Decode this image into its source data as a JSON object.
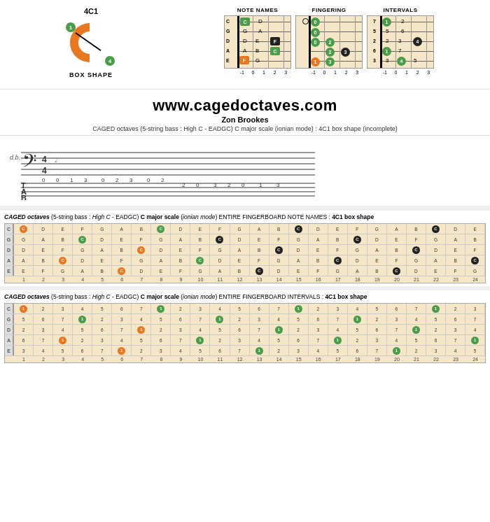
{
  "header": {
    "shape_label": "4C1",
    "box_shape_text": "BOX SHAPE",
    "dot1_label": "1",
    "dot4_label": "4",
    "diagrams": [
      {
        "title": "NOTE NAMES",
        "strings": [
          "C",
          "G",
          "D",
          "A",
          "E"
        ],
        "fret_nums": [
          "-1",
          "0",
          "1",
          "2",
          "3"
        ]
      },
      {
        "title": "FINGERING",
        "strings": [
          "0",
          "0",
          "0",
          "2",
          "1"
        ],
        "fret_nums": [
          "-1",
          "0",
          "1",
          "2",
          "3"
        ]
      },
      {
        "title": "INTERVALS",
        "strings": [
          "1",
          "5",
          "2",
          "6",
          "3"
        ],
        "fret_nums": [
          "-1",
          "0",
          "1",
          "2",
          "3"
        ]
      }
    ]
  },
  "website": {
    "url": "www.cagedoctaves.com",
    "author": "Zon Brookes",
    "description": "CAGED octaves (5-string bass : High C - EADGC) C major scale (ionian mode) : 4C1 box shape (incomplete)"
  },
  "fingerboard_notes": {
    "title_parts": {
      "caged": "CAGED octaves",
      "bass": "(5-string bass : High C - EADGC)",
      "scale": "C major scale",
      "mode": "(ionian mode)",
      "rest": "ENTIRE FINGERBOARD NOTE NAMES :",
      "shape": "4C1 box shape"
    },
    "string_names": [
      "C",
      "G",
      "D",
      "A",
      "E"
    ],
    "fret_count": 25,
    "fret_nums": [
      "1",
      "2",
      "3",
      "4",
      "5",
      "6",
      "7",
      "8",
      "9",
      "10",
      "11",
      "12",
      "13",
      "14",
      "15",
      "16",
      "17",
      "18",
      "19",
      "20",
      "21",
      "22",
      "23",
      "24"
    ],
    "rows": [
      {
        "string": "C",
        "cells": [
          "C",
          "D",
          "E",
          "F",
          "G",
          "A",
          "B",
          "C",
          "D",
          "E",
          "F",
          "G",
          "A",
          "B",
          "C",
          "D",
          "E",
          "F",
          "G",
          "A",
          "B",
          "C",
          "D",
          "E"
        ]
      },
      {
        "string": "G",
        "cells": [
          "G",
          "A",
          "B",
          "C",
          "D",
          "E",
          "F",
          "G",
          "A",
          "B",
          "C",
          "D",
          "E",
          "F",
          "G",
          "A",
          "B",
          "C",
          "D",
          "E",
          "F",
          "G",
          "A",
          "B"
        ]
      },
      {
        "string": "D",
        "cells": [
          "D",
          "E",
          "F",
          "G",
          "A",
          "B",
          "C",
          "D",
          "E",
          "F",
          "G",
          "A",
          "B",
          "C",
          "D",
          "E",
          "F",
          "G",
          "A",
          "B",
          "C",
          "D",
          "E",
          "F"
        ]
      },
      {
        "string": "A",
        "cells": [
          "A",
          "B",
          "C",
          "D",
          "E",
          "F",
          "G",
          "A",
          "B",
          "C",
          "D",
          "E",
          "F",
          "G",
          "A",
          "B",
          "C",
          "D",
          "E",
          "F",
          "G",
          "A",
          "B",
          "C"
        ]
      },
      {
        "string": "E",
        "cells": [
          "E",
          "F",
          "G",
          "A",
          "B",
          "C",
          "D",
          "E",
          "F",
          "G",
          "A",
          "B",
          "C",
          "D",
          "E",
          "F",
          "G",
          "A",
          "B",
          "C",
          "D",
          "E",
          "F",
          "G"
        ]
      }
    ],
    "highlights": {
      "orange": [
        [
          0,
          0
        ],
        [
          1,
          7
        ],
        [
          2,
          14
        ],
        [
          3,
          21
        ],
        [
          1,
          3
        ],
        [
          2,
          10
        ],
        [
          3,
          17
        ],
        [
          4,
          0
        ]
      ],
      "green_c": [
        [
          0,
          7
        ],
        [
          0,
          14
        ],
        [
          0,
          21
        ],
        [
          1,
          10
        ],
        [
          1,
          17
        ],
        [
          2,
          0
        ],
        [
          2,
          17
        ],
        [
          3,
          3
        ],
        [
          3,
          10
        ],
        [
          3,
          21
        ],
        [
          4,
          3
        ],
        [
          4,
          10
        ],
        [
          4,
          17
        ]
      ]
    }
  },
  "fingerboard_intervals": {
    "title_parts": {
      "caged": "CAGED octaves",
      "bass": "(5-string bass : High C - EADGC)",
      "scale": "C major scale",
      "mode": "(ionian mode)",
      "rest": "ENTIRE FINGERBOARD INTERVALS :",
      "shape": "4C1 box shape"
    },
    "string_names": [
      "C",
      "G",
      "D",
      "A",
      "E"
    ],
    "fret_nums": [
      "1",
      "2",
      "3",
      "4",
      "5",
      "6",
      "7",
      "8",
      "9",
      "10",
      "11",
      "12",
      "13",
      "14",
      "15",
      "16",
      "17",
      "18",
      "19",
      "20",
      "21",
      "22",
      "23",
      "24"
    ],
    "rows": [
      {
        "string": "C",
        "cells": [
          "1",
          "2",
          "3",
          "4",
          "5",
          "6",
          "7",
          "1",
          "2",
          "3",
          "4",
          "5",
          "6",
          "7",
          "1",
          "2",
          "3",
          "4",
          "5",
          "6",
          "7",
          "1",
          "2",
          "3"
        ]
      },
      {
        "string": "G",
        "cells": [
          "5",
          "6",
          "7",
          "1",
          "2",
          "3",
          "4",
          "5",
          "6",
          "7",
          "1",
          "2",
          "3",
          "4",
          "5",
          "6",
          "7",
          "1",
          "2",
          "3",
          "4",
          "5",
          "6",
          "7"
        ]
      },
      {
        "string": "D",
        "cells": [
          "2",
          "3",
          "4",
          "5",
          "6",
          "7",
          "1",
          "2",
          "3",
          "4",
          "5",
          "6",
          "7",
          "1",
          "2",
          "3",
          "4",
          "5",
          "6",
          "7",
          "1",
          "2",
          "3",
          "4"
        ]
      },
      {
        "string": "A",
        "cells": [
          "6",
          "7",
          "1",
          "2",
          "3",
          "4",
          "5",
          "6",
          "7",
          "1",
          "2",
          "3",
          "4",
          "5",
          "6",
          "7",
          "1",
          "2",
          "3",
          "4",
          "5",
          "6",
          "7",
          "1"
        ]
      },
      {
        "string": "E",
        "cells": [
          "3",
          "4",
          "5",
          "6",
          "7",
          "1",
          "2",
          "3",
          "4",
          "5",
          "6",
          "7",
          "1",
          "2",
          "3",
          "4",
          "5",
          "6",
          "7",
          "1",
          "2",
          "3",
          "4",
          "5"
        ]
      }
    ]
  }
}
